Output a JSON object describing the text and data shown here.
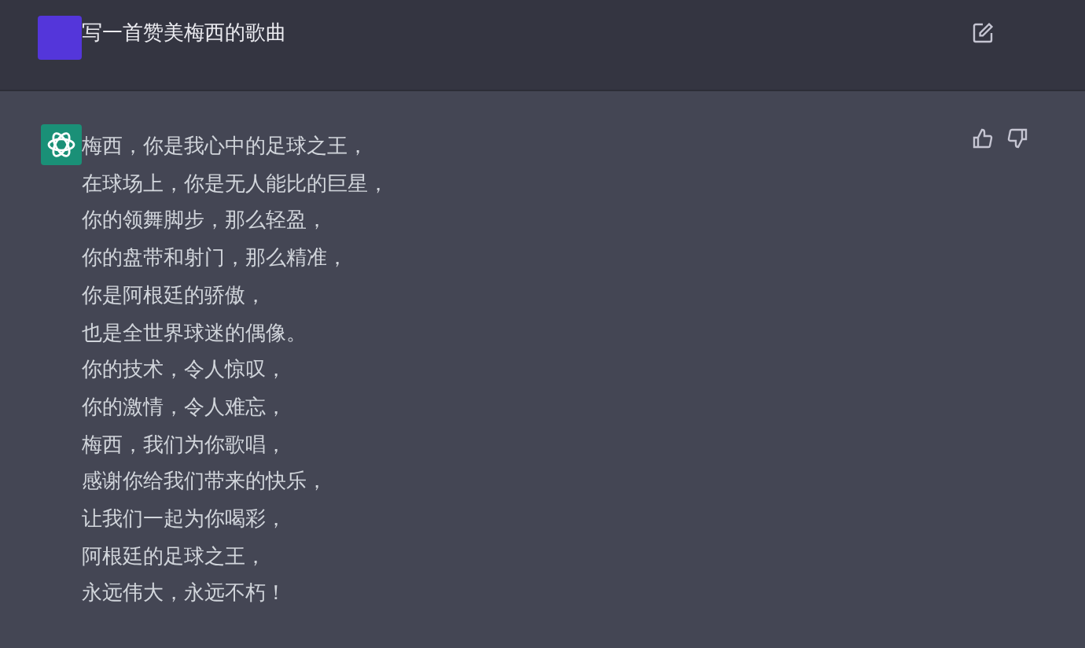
{
  "prompt": {
    "text": "写一首赞美梅西的歌曲"
  },
  "answer": {
    "lines": [
      "梅西，你是我心中的足球之王，",
      "在球场上，你是无人能比的巨星，",
      "你的领舞脚步，那么轻盈，",
      "你的盘带和射门，那么精准，",
      "你是阿根廷的骄傲，",
      "也是全世界球迷的偶像。",
      "你的技术，令人惊叹，",
      "你的激情，令人难忘，",
      "梅西，我们为你歌唱，",
      "感谢你给我们带来的快乐，",
      "让我们一起为你喝彩，",
      "阿根廷的足球之王，",
      "永远伟大，永远不朽！"
    ]
  }
}
